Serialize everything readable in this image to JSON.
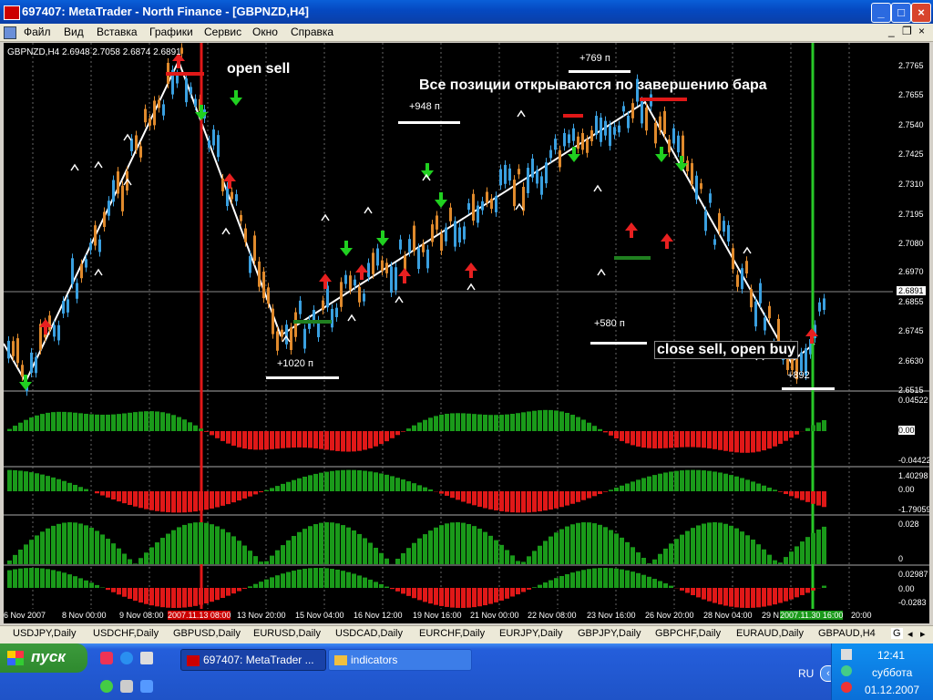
{
  "window": {
    "title": "697407: MetaTrader - North Finance - [GBPNZD,H4]"
  },
  "menu": [
    "Файл",
    "Вид",
    "Вставка",
    "Графики",
    "Сервис",
    "Окно",
    "Справка"
  ],
  "chart_info": "GBPNZD,H4  2.6948 2.7058 2.6874 2.6891",
  "price_axis": [
    "2.7765",
    "2.7655",
    "2.7540",
    "2.7425",
    "2.7310",
    "2.7195",
    "2.7080",
    "2.6970",
    "2.6855",
    "2.6745",
    "2.6630",
    "2.6515"
  ],
  "current_price": "2.6891",
  "annotations": {
    "open_sell": "open sell",
    "note": "Все позиции открываются по завершению бара",
    "close_sell": "close sell, open buy",
    "p948": "+948 п",
    "p769": "+769 п",
    "p1020": "+1020 п",
    "p580": "+580 п",
    "p892": "+892"
  },
  "indicators": {
    "ind1": [
      "0.04522",
      "0.00",
      "-0.04422"
    ],
    "ind2": [
      "1.40298",
      "0.00",
      "-1.79059"
    ],
    "ind3": [
      "0.028",
      "0"
    ],
    "ind4": [
      "0.02987",
      "0.00",
      "-0.0283"
    ]
  },
  "time_axis": [
    "6 Nov 2007",
    "8 Nov 00:00",
    "9 Nov 08:00",
    "2007.11.13 08:00",
    "13 Nov 20:00",
    "15 Nov 04:00",
    "16 Nov 12:00",
    "19 Nov 16:00",
    "21 Nov 00:00",
    "22 Nov 08:00",
    "23 Nov 16:00",
    "26 Nov 20:00",
    "28 Nov 04:00",
    "29 N",
    "2007.11.30 16:00",
    "20:00"
  ],
  "symbol_tabs": [
    "USDJPY,Daily",
    "USDCHF,Daily",
    "GBPUSD,Daily",
    "EURUSD,Daily",
    "USDCAD,Daily",
    "EURCHF,Daily",
    "EURJPY,Daily",
    "GBPJPY,Daily",
    "GBPCHF,Daily",
    "EURAUD,Daily",
    "GBPAUD,H4",
    "G"
  ],
  "taskbar": {
    "start": "пуск",
    "task1": "697407: MetaTrader ...",
    "task2": "indicators",
    "lang": "RU",
    "time": "12:41",
    "day": "суббота",
    "date": "01.12.2007"
  },
  "colors": {
    "bull": "#e08a2c",
    "bear": "#3aa0e0",
    "up_arrow": "#e82020",
    "down_arrow": "#20d020"
  }
}
